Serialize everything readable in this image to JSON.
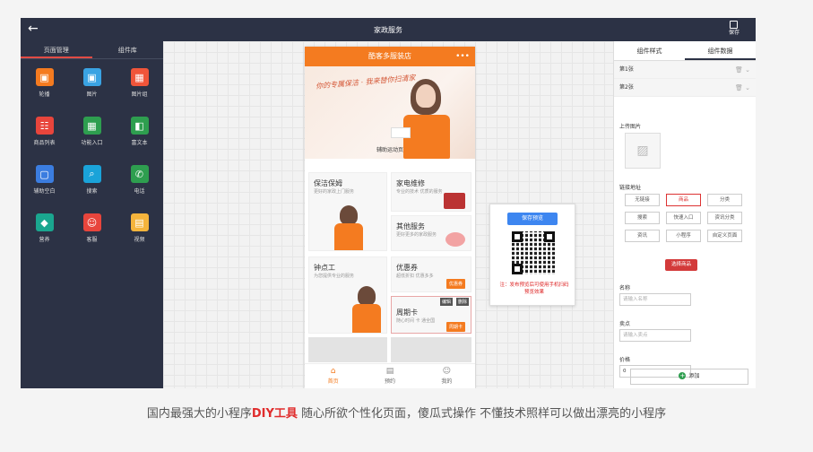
{
  "header": {
    "title": "家政服务",
    "save_label": "保存",
    "back_glyph": "←"
  },
  "left_panel": {
    "tabs": [
      "页面管理",
      "组件库"
    ],
    "widgets": [
      {
        "label": "轮播",
        "color": "#f47b20",
        "glyph": "▣"
      },
      {
        "label": "图片",
        "color": "#3aa3e3",
        "glyph": "▣"
      },
      {
        "label": "图片组",
        "color": "#f0553a",
        "glyph": "▦"
      },
      {
        "label": "商品列表",
        "color": "#e8453c",
        "glyph": "☷"
      },
      {
        "label": "功能入口",
        "color": "#2e9e4f",
        "glyph": "▦"
      },
      {
        "label": "富文本",
        "color": "#2e9e4f",
        "glyph": "◧"
      },
      {
        "label": "辅助空白",
        "color": "#3b7de0",
        "glyph": "▢"
      },
      {
        "label": "搜索",
        "color": "#1aa3d9",
        "glyph": "⌕"
      },
      {
        "label": "电话",
        "color": "#2e9e4f",
        "glyph": "✆"
      },
      {
        "label": "营养",
        "color": "#1aa68f",
        "glyph": "◆"
      },
      {
        "label": "客服",
        "color": "#e8453c",
        "glyph": "☺"
      },
      {
        "label": "视频",
        "color": "#f5b43c",
        "glyph": "▤"
      }
    ]
  },
  "phone": {
    "title": "酷客多服装店",
    "menu": "•••",
    "banner_text": "你的专属保洁 · 我来替你扫清家",
    "banner_link": "辅助运动页",
    "cards": {
      "c1": {
        "title": "保洁保姆",
        "sub": "更好的家政上门服务"
      },
      "c2": {
        "title": "家电维修",
        "sub": "专业的技术 优质的服务"
      },
      "c3": {
        "title": "其他服务",
        "sub": "更好更多的家政服务"
      },
      "c4": {
        "title": "钟点工",
        "sub": "为您提供专业的服务"
      },
      "c5": {
        "title": "优惠券",
        "sub": "超低折扣 优惠多多",
        "btn": "优惠券"
      },
      "c6": {
        "title": "周期卡",
        "sub": "随心时间 卡 通全国",
        "btn": "周期卡",
        "tag1": "编辑",
        "tag2": "删除"
      }
    },
    "tabs": [
      {
        "label": "首页",
        "icon": "⌂"
      },
      {
        "label": "预约",
        "icon": "▤"
      },
      {
        "label": "我的",
        "icon": "☺"
      }
    ]
  },
  "qr": {
    "button": "保存预览",
    "note": "注：发布预览后可使用手机扫码预览效果"
  },
  "right_panel": {
    "tabs": [
      "组件样式",
      "组件数据"
    ],
    "rows": [
      "第1张",
      "第2张"
    ],
    "row_icons": "🗑 ⌄",
    "upload_label": "上传图片",
    "link_label": "链接地址",
    "link_options": [
      "无链接",
      "商品",
      "分类",
      "搜索",
      "快速入口",
      "资讯分类",
      "资讯",
      "小程序",
      "自定义页面"
    ],
    "pick_button": "选择商品",
    "name_label": "名称",
    "name_placeholder": "请输入名称",
    "sell_label": "卖点",
    "sell_placeholder": "请输入卖点",
    "price_label": "价格",
    "price_value": "0",
    "add_button": "添加"
  },
  "caption": {
    "part1": "国内最强大的小程序",
    "highlight": "DIY工具",
    "part2": "随心所欲个性化页面，傻瓜式操作 不懂技术照样可以做出漂亮的小程序"
  }
}
